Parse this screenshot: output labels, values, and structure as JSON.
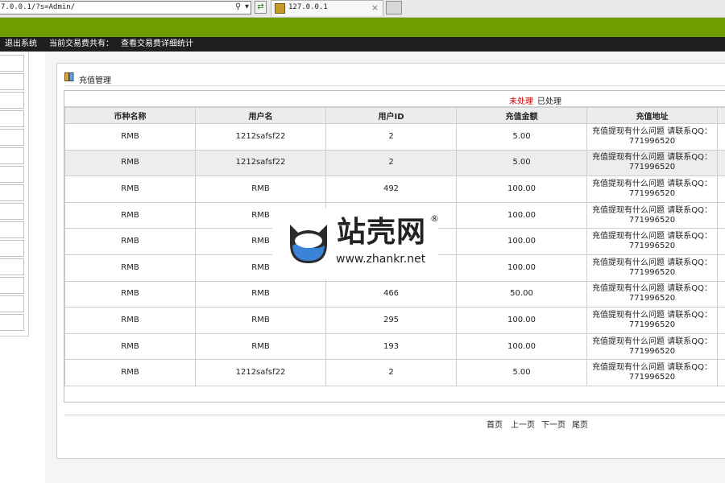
{
  "browser": {
    "address": "7.0.0.1/?s=Admin/",
    "search_icon": "magnifier-icon",
    "dropdown_icon": "chevron-down-icon",
    "go_icon": "refresh-arrows-icon",
    "tab_title": "127.0.0.1",
    "tab_close": "×"
  },
  "nav": {
    "logout": "退出系统",
    "fee_label": "当前交易费共有：",
    "fee_link": "查看交易费详细统计"
  },
  "panel": {
    "title": "充值管理",
    "filter_unprocessed": "未处理",
    "filter_processed": "已处理"
  },
  "table": {
    "headers": [
      "币种名称",
      "用户名",
      "用户ID",
      "充值金额",
      "充值地址"
    ],
    "rows": [
      {
        "currency": "RMB",
        "username": "1212safsf22",
        "uid": "2",
        "amount": "5.00",
        "address": "充值提现有什么问题 请联系QQ：771996520"
      },
      {
        "currency": "RMB",
        "username": "1212safsf22",
        "uid": "2",
        "amount": "5.00",
        "address": "充值提现有什么问题 请联系QQ：771996520"
      },
      {
        "currency": "RMB",
        "username": "RMB",
        "uid": "492",
        "amount": "100.00",
        "address": "充值提现有什么问题 请联系QQ：771996520"
      },
      {
        "currency": "RMB",
        "username": "RMB",
        "uid": "",
        "amount": "100.00",
        "address": "充值提现有什么问题 请联系QQ：771996520"
      },
      {
        "currency": "RMB",
        "username": "RMB",
        "uid": "",
        "amount": "100.00",
        "address": "充值提现有什么问题 请联系QQ：771996520"
      },
      {
        "currency": "RMB",
        "username": "RMB",
        "uid": "",
        "amount": "100.00",
        "address": "充值提现有什么问题 请联系QQ：771996520"
      },
      {
        "currency": "RMB",
        "username": "RMB",
        "uid": "466",
        "amount": "50.00",
        "address": "充值提现有什么问题 请联系QQ：771996520"
      },
      {
        "currency": "RMB",
        "username": "RMB",
        "uid": "295",
        "amount": "100.00",
        "address": "充值提现有什么问题 请联系QQ：771996520"
      },
      {
        "currency": "RMB",
        "username": "RMB",
        "uid": "193",
        "amount": "100.00",
        "address": "充值提现有什么问题 请联系QQ：771996520"
      },
      {
        "currency": "RMB",
        "username": "1212safsf22",
        "uid": "2",
        "amount": "5.00",
        "address": "充值提现有什么问题 请联系QQ：771996520"
      }
    ]
  },
  "pager": {
    "first": "首页",
    "prev": "上一页",
    "next": "下一页",
    "last": "尾页"
  },
  "watermark": {
    "brand": "站壳网",
    "reg": "®",
    "url": "www.zhankr.net"
  }
}
